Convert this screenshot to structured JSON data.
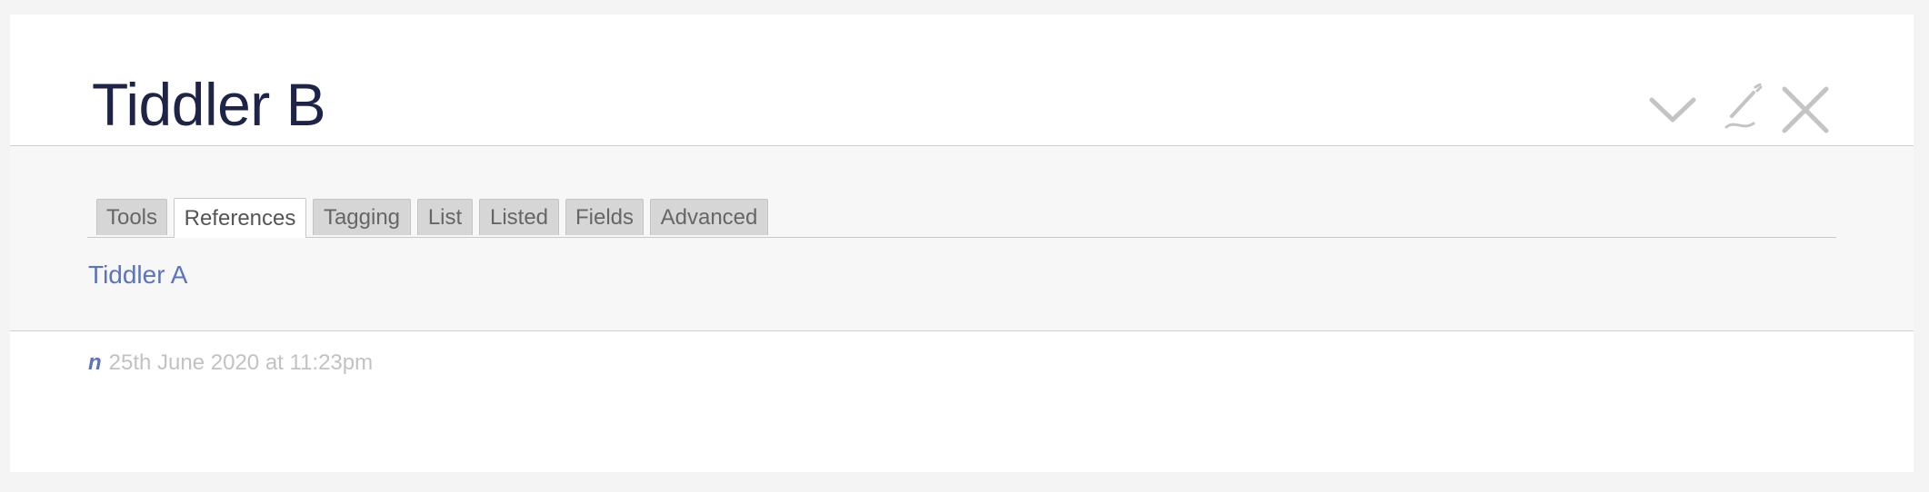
{
  "tiddler": {
    "title": "Tiddler B",
    "modifier": "n",
    "modified": "25th June 2020 at 11:23pm"
  },
  "controls": {
    "icons": [
      "chevron-down-icon",
      "edit-pencil-icon",
      "close-icon"
    ],
    "icon_color": "#c4c4c4"
  },
  "info": {
    "tabs": [
      {
        "label": "Tools",
        "active": false
      },
      {
        "label": "References",
        "active": true
      },
      {
        "label": "Tagging",
        "active": false
      },
      {
        "label": "List",
        "active": false
      },
      {
        "label": "Listed",
        "active": false
      },
      {
        "label": "Fields",
        "active": false
      },
      {
        "label": "Advanced",
        "active": false
      }
    ],
    "references": [
      "Tiddler A"
    ]
  },
  "colors": {
    "title": "#1d2447",
    "link": "#5b74bd",
    "panel_bg": "#f7f7f7",
    "tab_bg": "#d6d6d6"
  }
}
